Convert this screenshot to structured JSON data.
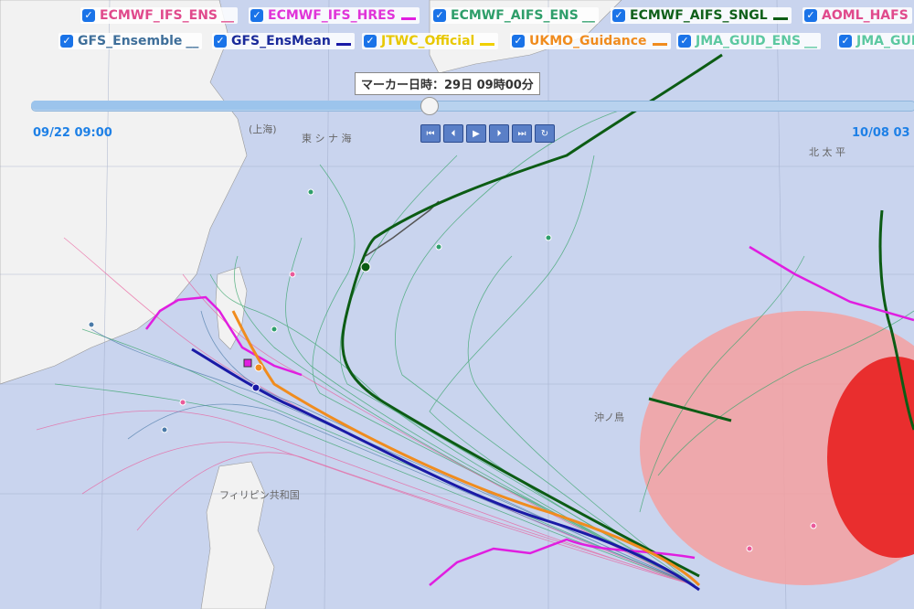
{
  "legend": {
    "row1": [
      {
        "label": "ECMWF_IFS_ENS",
        "suffix": "__",
        "color": "#e04a8c",
        "swatch": ""
      },
      {
        "label": "ECMWF_IFS_HRES",
        "suffix": "",
        "color": "#e034d8",
        "swatch": "#e01ee0"
      },
      {
        "label": "ECMWF_AIFS_ENS",
        "suffix": "__",
        "color": "#2e9e6a",
        "swatch": ""
      },
      {
        "label": "ECMWF_AIFS_SNGL",
        "suffix": "",
        "color": "#10601a",
        "swatch": "#0c5c14"
      },
      {
        "label": "AOML_HAFS",
        "suffix": "",
        "color": "#e04a8c",
        "swatch": ""
      }
    ],
    "row2": [
      {
        "label": "GFS_Ensemble",
        "suffix": "__",
        "color": "#3f6f9a",
        "swatch": ""
      },
      {
        "label": "GFS_EnsMean",
        "suffix": "",
        "color": "#1a2a9a",
        "swatch": "#1a1aa6"
      },
      {
        "label": "JTWC_Official",
        "suffix": "",
        "color": "#e8c800",
        "swatch": "#f0d000"
      },
      {
        "label": "UKMO_Guidance",
        "suffix": "",
        "color": "#f08c1e",
        "swatch": "#f08c1e"
      },
      {
        "label": "JMA_GUID_ENS",
        "suffix": "__",
        "color": "#5cc8a0",
        "swatch": ""
      },
      {
        "label": "JMA_GUI",
        "suffix": "",
        "color": "#5cc8a0",
        "swatch": ""
      }
    ]
  },
  "timeline": {
    "marker_text": "マーカー日時：29日 09時00分",
    "start_label": "09/22 09:00",
    "end_label": "10/08 03",
    "position_fraction": 0.45
  },
  "controls": [
    "⏮",
    "⏴",
    "▶",
    "⏵",
    "⏭",
    "↻"
  ],
  "map_labels": {
    "east_china_sea": "東 シ ナ 海",
    "pacific": "北 太 平",
    "shanghai": "(上海)",
    "philippines": "フィリピン共和国",
    "okino": "沖ノ鳥"
  }
}
